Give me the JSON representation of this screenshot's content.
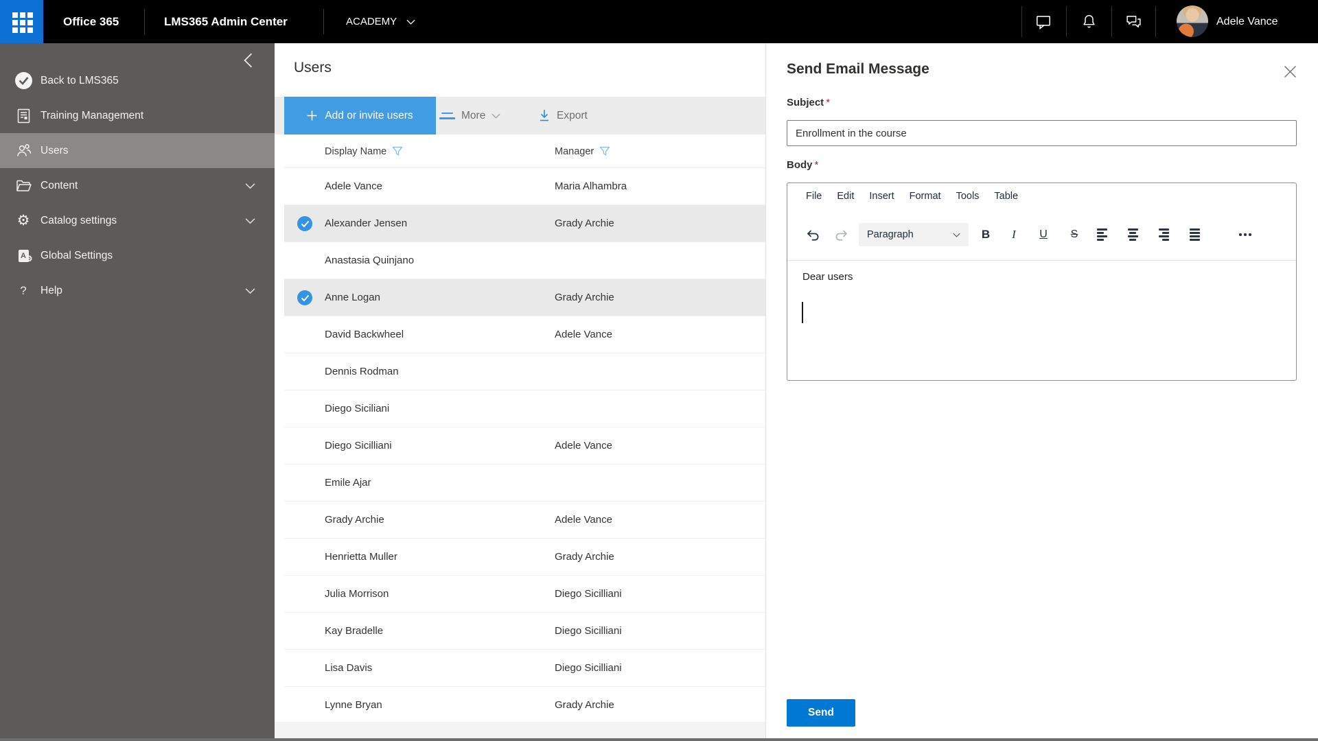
{
  "topbar": {
    "brand": "Office 365",
    "app_title": "LMS365 Admin Center",
    "tenant_menu": "ACADEMY",
    "user_name": "Adele Vance",
    "icons": [
      "app-launcher",
      "chat",
      "notifications",
      "feedback",
      "avatar"
    ]
  },
  "sidebar": {
    "items": [
      {
        "label": "Back to LMS365",
        "icon": "lms365-logo-icon",
        "expandable": false,
        "selected": false
      },
      {
        "label": "Training Management",
        "icon": "training-management-icon",
        "expandable": false,
        "selected": false
      },
      {
        "label": "Users",
        "icon": "users-icon",
        "expandable": false,
        "selected": true
      },
      {
        "label": "Content",
        "icon": "folder-icon",
        "expandable": true,
        "selected": false
      },
      {
        "label": "Catalog settings",
        "icon": "gear-icon",
        "expandable": true,
        "selected": false
      },
      {
        "label": "Global Settings",
        "icon": "global-settings-icon",
        "expandable": false,
        "selected": false
      },
      {
        "label": "Help",
        "icon": "help-icon",
        "expandable": true,
        "selected": false
      }
    ]
  },
  "users_list": {
    "title": "Users",
    "toolbar": {
      "add_button": "Add or invite users",
      "more_button": "More",
      "export_button": "Export"
    },
    "columns": [
      "Display Name",
      "Manager"
    ],
    "rows": [
      {
        "name": "Adele Vance",
        "manager": "Maria Alhambra",
        "selected": false
      },
      {
        "name": "Alexander Jensen",
        "manager": "Grady Archie",
        "selected": true
      },
      {
        "name": "Anastasia Quinjano",
        "manager": "",
        "selected": false
      },
      {
        "name": "Anne Logan",
        "manager": "Grady Archie",
        "selected": true
      },
      {
        "name": "David Backwheel",
        "manager": "Adele Vance",
        "selected": false
      },
      {
        "name": "Dennis Rodman",
        "manager": "",
        "selected": false
      },
      {
        "name": "Diego Siciliani",
        "manager": "",
        "selected": false
      },
      {
        "name": "Diego Sicilliani",
        "manager": "Adele Vance",
        "selected": false
      },
      {
        "name": "Emile Ajar",
        "manager": "",
        "selected": false
      },
      {
        "name": "Grady Archie",
        "manager": "Adele Vance",
        "selected": false
      },
      {
        "name": "Henrietta Muller",
        "manager": "Grady Archie",
        "selected": false
      },
      {
        "name": "Julia Morrison",
        "manager": "Diego Sicilliani",
        "selected": false
      },
      {
        "name": "Kay Bradelle",
        "manager": "Diego Sicilliani",
        "selected": false
      },
      {
        "name": "Lisa Davis",
        "manager": "Diego Sicilliani",
        "selected": false
      },
      {
        "name": "Lynne Bryan",
        "manager": "Grady Archie",
        "selected": false
      }
    ]
  },
  "email_panel": {
    "title": "Send Email Message",
    "required_marker": "*",
    "subject_label": "Subject",
    "subject_value": "Enrollment in the course",
    "body_label": "Body",
    "editor": {
      "menus": [
        "File",
        "Edit",
        "Insert",
        "Format",
        "Tools",
        "Table"
      ],
      "format_dropdown": "Paragraph",
      "glyphs": {
        "bold": "B",
        "italic": "I",
        "underline": "U",
        "strikethrough": "S"
      },
      "toolbar_buttons": [
        "undo",
        "redo",
        "paragraph-format",
        "bold",
        "italic",
        "underline",
        "strikethrough",
        "align-left",
        "align-center",
        "align-right",
        "justify",
        "more-options"
      ],
      "body_text": "Dear users"
    },
    "send_button": "Send"
  },
  "colors": {
    "topbar_bg": "#000000",
    "app_launcher_blue": "#0d70d4",
    "sidebar_bg": "#5d5b59",
    "sidebar_selected_bg": "#8b8987",
    "toolbar_strip_bg": "#ececec",
    "add_button_blue": "#429ce3",
    "row_selected_bg": "#e9e9e9",
    "check_badge_blue": "#3394e4",
    "send_button_blue": "#0078d4",
    "required_red": "#a4262c",
    "editor_text": "#222f3e"
  }
}
